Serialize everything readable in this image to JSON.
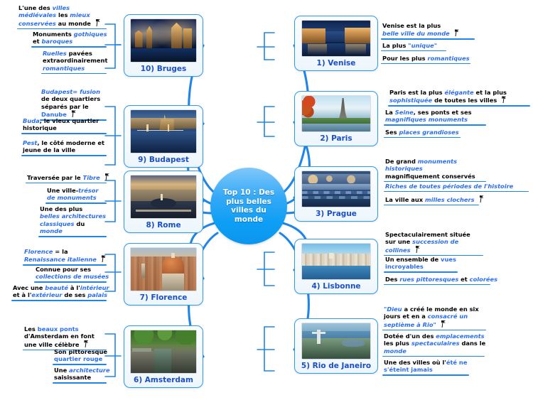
{
  "center": {
    "title": "Top 10 : Des plus belles villes du monde",
    "color": "#0d9ef5"
  },
  "theme": {
    "branch_color": "#1f86e8",
    "node_border": "#3399e6",
    "label_color": "#1a4fc4",
    "accent_text": "#2a6ef0",
    "icon": "pushpin-icon"
  },
  "cities": [
    {
      "id": "bruges",
      "label": "10) Bruges",
      "image": "bruges-canal-night-photo",
      "branches": [
        "L'une des villes médiévales les mieux conservées au monde",
        "Monuments gothiques et baroques",
        "Ruelles pavées extraordinairement romantiques"
      ]
    },
    {
      "id": "budapest",
      "label": "9) Budapest",
      "image": "budapest-danube-chain-bridge-photo",
      "branches": [
        "Budapest= fusion de deux quartiers séparés par le Danube",
        "Buda, le vieux quartier historique",
        "Pest, le côté moderne et jeune de la ville"
      ]
    },
    {
      "id": "rome",
      "label": "8) Rome",
      "image": "rome-st-peters-square-photo",
      "branches": [
        "Traversée par le Tibre",
        "Une ville-trésor de monuments",
        "Une des plus belles architectures classiques du monde"
      ]
    },
    {
      "id": "florence",
      "label": "7) Florence",
      "image": "florence-duomo-photo",
      "branches": [
        "Florence = la Renaissance italienne",
        "Connue pour ses collections de musées",
        "Avec une beauté à l'intérieur et à l'extérieur de ses palais"
      ]
    },
    {
      "id": "amsterdam",
      "label": "6) Amsterdam",
      "image": "amsterdam-canal-bikes-photo",
      "branches": [
        "Les beaux ponts d'Amsterdam en font une ville célèbre",
        "Son pittoresque quartier rouge",
        "Une architecture saisissante"
      ]
    },
    {
      "id": "venise",
      "label": "1) Venise",
      "image": "venice-grand-canal-night-photo",
      "branches": [
        "Venise est la plus belle ville du monde",
        "La plus \"unique\"",
        "Pour les plus romantiques"
      ]
    },
    {
      "id": "paris",
      "label": "2) Paris",
      "image": "paris-eiffel-tower-autumn-photo",
      "branches": [
        "Paris est la plus élégante et la plus sophistiquée de toutes les villes",
        "La Seine, ses ponts et ses magnifiques monuments",
        "Ses places grandioses"
      ]
    },
    {
      "id": "prague",
      "label": "3) Prague",
      "image": "prague-charles-bridge-photo",
      "branches": [
        "De grand monuments historiques magnifiquement conservés",
        "Riches de toutes périodes de l'histoire",
        "La ville aux milles clochers"
      ]
    },
    {
      "id": "lisbonne",
      "label": "4) Lisbonne",
      "image": "lisbon-hillside-waterfront-photo",
      "branches": [
        "Spectaculairement située sur une succession de collines",
        "Un ensemble de vues incroyables",
        "Des rues pittoresques et colorées"
      ]
    },
    {
      "id": "rio",
      "label": "5) Rio de Janeiro",
      "image": "rio-christ-redeemer-photo",
      "branches": [
        "\"Dieu a créé le monde en six jours et en a consacré un septième à Rio\"",
        "Dotée d'un des emplacements les plus spectaculaires dans le monde",
        "Une des villes où l'été ne s'éteint jamais"
      ]
    }
  ]
}
